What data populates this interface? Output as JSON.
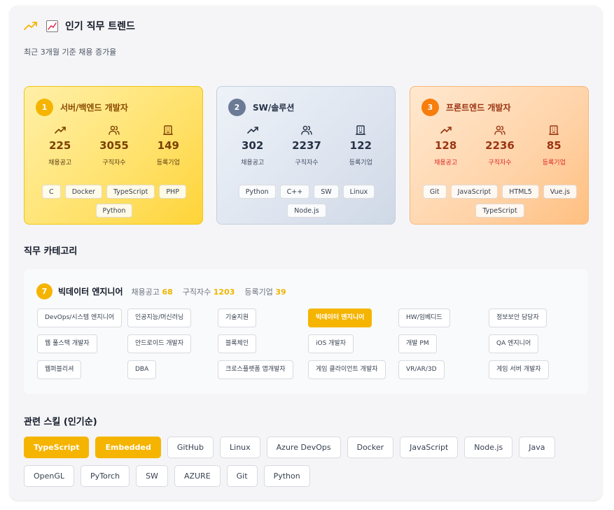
{
  "header": {
    "title": "인기 직무 트렌드",
    "subtitle": "최근 3개월 기준 채용 증가율"
  },
  "top_jobs": [
    {
      "rank": "1",
      "title": "서버/백엔드 개발자",
      "stats": [
        {
          "value": "225",
          "label": "채용공고"
        },
        {
          "value": "3055",
          "label": "구직자수"
        },
        {
          "value": "149",
          "label": "등록기업"
        }
      ],
      "tags": [
        "C",
        "Docker",
        "TypeScript",
        "PHP",
        "Python"
      ]
    },
    {
      "rank": "2",
      "title": "SW/솔루션",
      "stats": [
        {
          "value": "302",
          "label": "채용공고"
        },
        {
          "value": "2237",
          "label": "구직자수"
        },
        {
          "value": "122",
          "label": "등록기업"
        }
      ],
      "tags": [
        "Python",
        "C++",
        "SW",
        "Linux",
        "Node.js"
      ]
    },
    {
      "rank": "3",
      "title": "프론트엔드 개발자",
      "stats": [
        {
          "value": "128",
          "label": "채용공고"
        },
        {
          "value": "2236",
          "label": "구직자수"
        },
        {
          "value": "85",
          "label": "등록기업"
        }
      ],
      "tags": [
        "Git",
        "JavaScript",
        "HTML5",
        "Vue.js",
        "TypeScript"
      ]
    }
  ],
  "categories_section": {
    "title": "직무 카테고리",
    "selected": {
      "rank": "7",
      "name": "빅데이터 엔지니어",
      "postings_label": "채용공고",
      "postings": "68",
      "seekers_label": "구직자수",
      "seekers": "1203",
      "companies_label": "등록기업",
      "companies": "39"
    },
    "items": [
      "DevOps/시스템 엔지니어",
      "인공지능/머신러닝",
      "기술지원",
      "빅데이터 엔지니어",
      "HW/임베디드",
      "정보보안 담당자",
      "웹 풀스택 개발자",
      "안드로이드 개발자",
      "블록체인",
      "iOS 개발자",
      "개발 PM",
      "QA 엔지니어",
      "웹퍼블리셔",
      "DBA",
      "크로스플랫폼 앱개발자",
      "게임 클라이언트 개발자",
      "VR/AR/3D",
      "게임 서버 개발자"
    ],
    "active_item": "빅데이터 엔지니어"
  },
  "skills_section": {
    "title": "관련 스킬 (인기순)",
    "items": [
      "TypeScript",
      "Embedded",
      "GitHub",
      "Linux",
      "Azure DevOps",
      "Docker",
      "JavaScript",
      "Node.js",
      "Java",
      "OpenGL",
      "PyTorch",
      "SW",
      "AZURE",
      "Git",
      "Python"
    ],
    "highlighted": [
      "TypeScript",
      "Embedded"
    ]
  },
  "colors": {
    "accent": "#f5b400",
    "rank2": "#6b7a95",
    "rank3": "#f77d0c"
  },
  "icons": [
    "trending-up-icon",
    "chart-emoji-icon",
    "users-icon",
    "building-icon"
  ]
}
